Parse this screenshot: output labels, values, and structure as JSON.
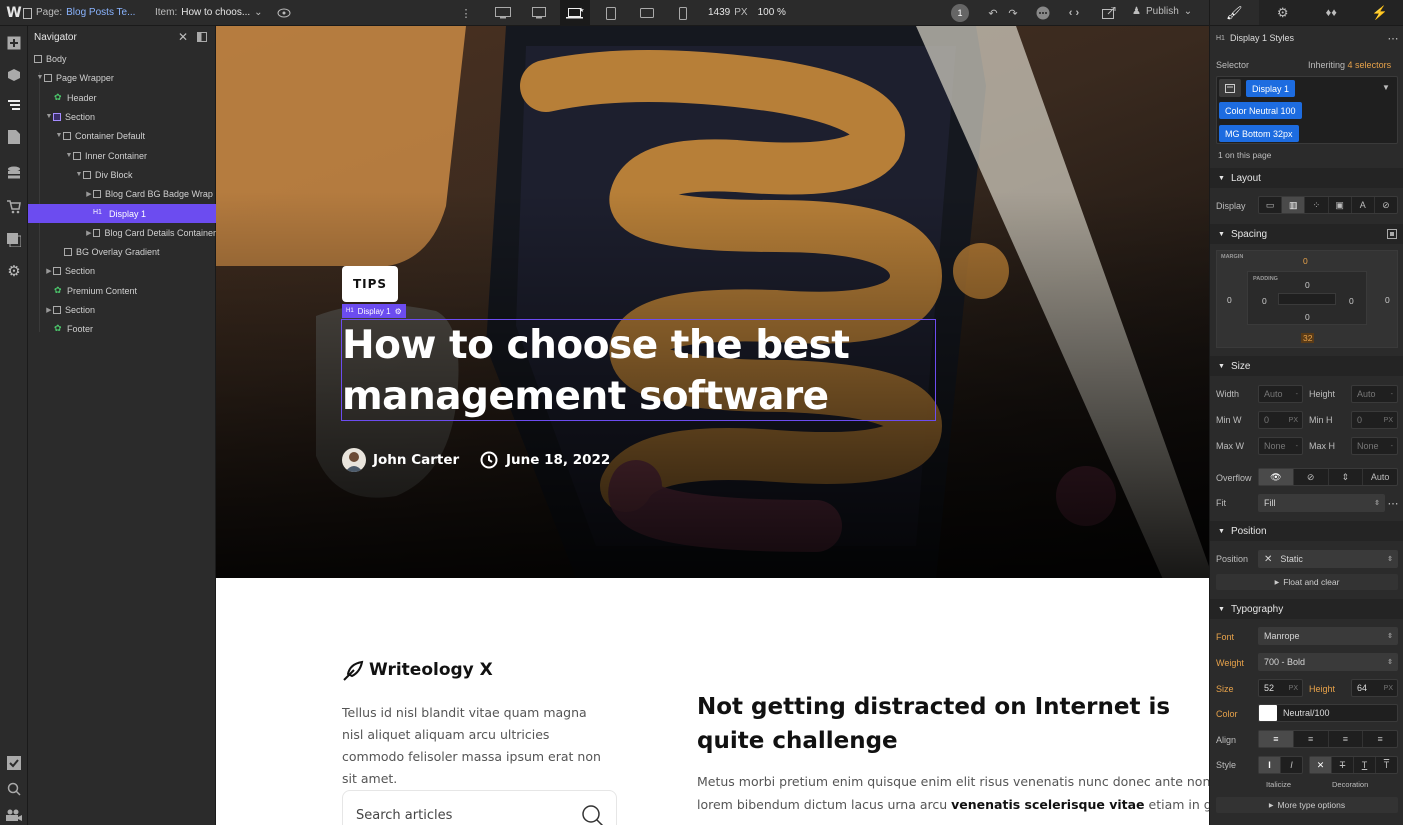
{
  "topbar": {
    "page_label": "Page:",
    "page_value": "Blog Posts Te...",
    "item_label": "Item:",
    "item_value": "How to choos...",
    "width_value": "1439",
    "width_unit": "PX",
    "zoom": "100 %",
    "badge_count": "1",
    "publish": "Publish"
  },
  "navigator": {
    "title": "Navigator",
    "items": [
      {
        "label": "Body"
      },
      {
        "label": "Page Wrapper"
      },
      {
        "label": "Header"
      },
      {
        "label": "Section"
      },
      {
        "label": "Container Default"
      },
      {
        "label": "Inner Container"
      },
      {
        "label": "Div Block"
      },
      {
        "label": "Blog Card BG Badge Wrap"
      },
      {
        "label": "Display 1"
      },
      {
        "label": "Blog Card Details Container"
      },
      {
        "label": "BG Overlay Gradient"
      },
      {
        "label": "Section"
      },
      {
        "label": "Premium Content"
      },
      {
        "label": "Section"
      },
      {
        "label": "Footer"
      }
    ]
  },
  "canvas": {
    "badge": "TIPS",
    "sel_tag": "Display 1",
    "h1_tag": "H1",
    "title_line1": "How to choose the best",
    "title_line2": "management software",
    "author": "John Carter",
    "date": "June 18, 2022",
    "logo": "Writeology X",
    "intro": "Tellus id nisl blandit vitae quam magna nisl aliquet aliquam arcu ultricies commodo felisoler massa ipsum erat non sit amet.",
    "search_placeholder": "Search articles",
    "article_h2": "Not getting distracted on Internet is quite challenge",
    "article_p1": "Metus morbi pretium enim quisque enim elit risus venenatis nunc donec ante non dictum",
    "article_p2a": "lorem bibendum dictum lacus urna arcu ",
    "article_p2b": "venenatis scelerisque vitae",
    "article_p2c": " etiam in gravida"
  },
  "panel": {
    "h1_tag": "H1",
    "styles_title": "Display 1 Styles",
    "selector_label": "Selector",
    "inheriting": "Inheriting",
    "selectors_count": "4 selectors",
    "chips": [
      "Display 1",
      "Color Neutral 100",
      "MG Bottom 32px"
    ],
    "on_page": "1 on this page",
    "layout": "Layout",
    "display": "Display",
    "spacing": "Spacing",
    "margin_label": "MARGIN",
    "padding_label": "PADDING",
    "margin": {
      "top": "0",
      "right": "0",
      "bottom": "32",
      "left": "0"
    },
    "padding": {
      "top": "0",
      "right": "0",
      "bottom": "0",
      "left": "0"
    },
    "size": "Size",
    "width": "Width",
    "height": "Height",
    "min_w": "Min W",
    "min_h": "Min H",
    "max_w": "Max W",
    "max_h": "Max H",
    "auto": "Auto",
    "zero": "0",
    "none": "None",
    "px": "PX",
    "dash": "-",
    "overflow": "Overflow",
    "overflow_auto": "Auto",
    "fit": "Fit",
    "fit_value": "Fill",
    "position_h": "Position",
    "position": "Position",
    "position_value": "Static",
    "float_clear": "Float and clear",
    "typography": "Typography",
    "font": "Font",
    "font_value": "Manrope",
    "weight": "Weight",
    "weight_value": "700 - Bold",
    "size_l": "Size",
    "size_value": "52",
    "height_l": "Height",
    "height_value": "64",
    "color": "Color",
    "color_value": "Neutral/100",
    "align": "Align",
    "style": "Style",
    "italicize": "Italicize",
    "decoration": "Decoration",
    "more_type": "More type options"
  },
  "colors": {
    "accent": "#6c4cf0",
    "chip": "#1d6ce0",
    "orange": "#e7a24a"
  }
}
